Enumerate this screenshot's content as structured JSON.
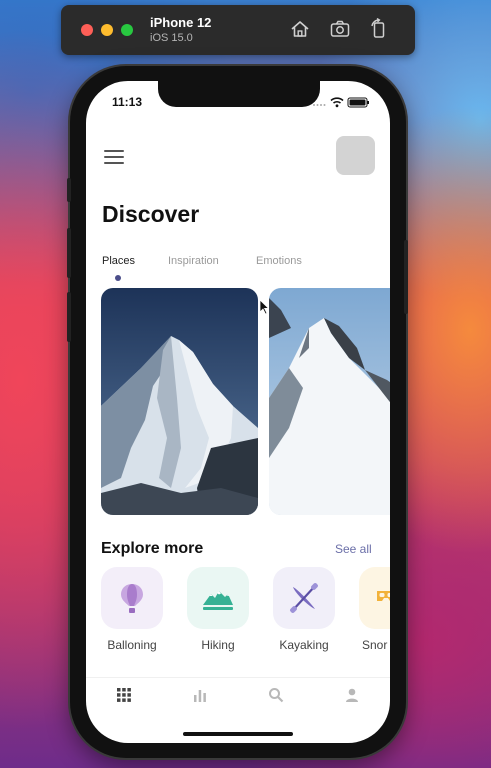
{
  "simulator": {
    "device_name": "iPhone 12",
    "os_version": "iOS 15.0",
    "toolbar_buttons": [
      "home-icon",
      "screenshot-icon",
      "rotate-icon"
    ]
  },
  "status_bar": {
    "time": "11:13",
    "icons": [
      "signal-icon",
      "wifi-icon",
      "battery-icon"
    ]
  },
  "header": {
    "title": "Discover",
    "menu_icon": "hamburger-menu-icon"
  },
  "tabs": [
    {
      "label": "Places",
      "active": true
    },
    {
      "label": "Inspiration",
      "active": false
    },
    {
      "label": "Emotions",
      "active": false
    }
  ],
  "cards": [
    {
      "image": "snowy-mountain-peak"
    },
    {
      "image": "snowy-mountain-ridge"
    }
  ],
  "explore": {
    "title": "Explore more",
    "see_all": "See all",
    "activities": [
      {
        "label": "Balloning",
        "icon": "hot-air-balloon-icon",
        "bg": "#f3eef9",
        "color": "#b27fd0"
      },
      {
        "label": "Hiking",
        "icon": "mountains-icon",
        "bg": "#eaf7f3",
        "color": "#36b194"
      },
      {
        "label": "Kayaking",
        "icon": "kayak-icon",
        "bg": "#f1eff9",
        "color": "#7a6cc0"
      },
      {
        "label": "Snor",
        "icon": "snorkel-icon",
        "bg": "#fdf5e3",
        "color": "#f2b23a"
      }
    ]
  },
  "bottom_nav": [
    "grid-icon",
    "chart-icon",
    "search-icon",
    "profile-icon"
  ],
  "colors": {
    "accent": "#4b4e8a",
    "see_all": "#6b6fa8"
  }
}
